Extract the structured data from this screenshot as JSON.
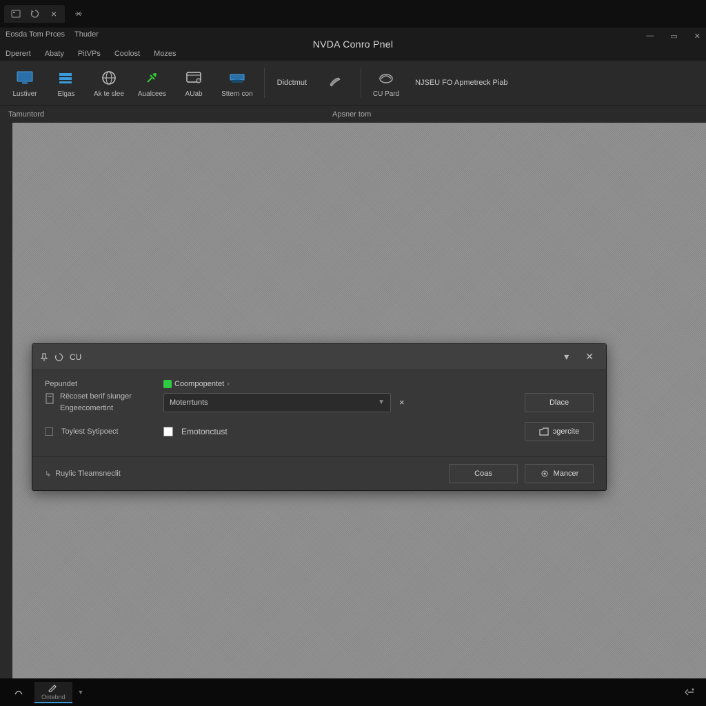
{
  "titlebar": {
    "tab_close": "×",
    "new_tab": "+"
  },
  "header": {
    "app_title": "NVDA Conro Pnel",
    "menu1": [
      "Eosda Tom Prces",
      "Thuder"
    ],
    "menu2": [
      "Dperert",
      "Abaty",
      "PitVPs",
      "Coolost",
      "Mozes"
    ],
    "win": {
      "min": "—",
      "max": "▭",
      "close": "✕"
    }
  },
  "toolbar": {
    "items": [
      {
        "label": "Lustiver"
      },
      {
        "label": "Elgas"
      },
      {
        "label": "Ak te slee"
      },
      {
        "label": "Aualcees"
      },
      {
        "label": "AUab"
      },
      {
        "label": "Sttern con"
      }
    ],
    "right": [
      {
        "label": "Didctmut"
      },
      {
        "label": ""
      },
      {
        "label": "CU Pard"
      },
      {
        "label": "NJSEU FO Apmetreck Piab"
      }
    ]
  },
  "subheader": {
    "left": "Tamuntord",
    "right": "Apsner tom"
  },
  "dialog": {
    "title": "CU",
    "section_label": "Pepundet",
    "row1_line1": "Rëcoset berif siunger",
    "row1_line2": "Engeecomertint",
    "tag_label": "Coompopentet",
    "select_value": "Moterrtunts",
    "clear": "×",
    "btn_close": "Dlace",
    "chk_label": "Toylest Sytipoect",
    "chk2_label": "Emotonctust",
    "btn_generate": "ɔgercite",
    "footer_label": "Ruylic Tleamsneclit",
    "btn_coas": "Coas",
    "btn_mancer": "Mancer"
  },
  "taskbar": {
    "items": [
      {
        "label": ""
      },
      {
        "label": "Ontebnd"
      }
    ]
  }
}
